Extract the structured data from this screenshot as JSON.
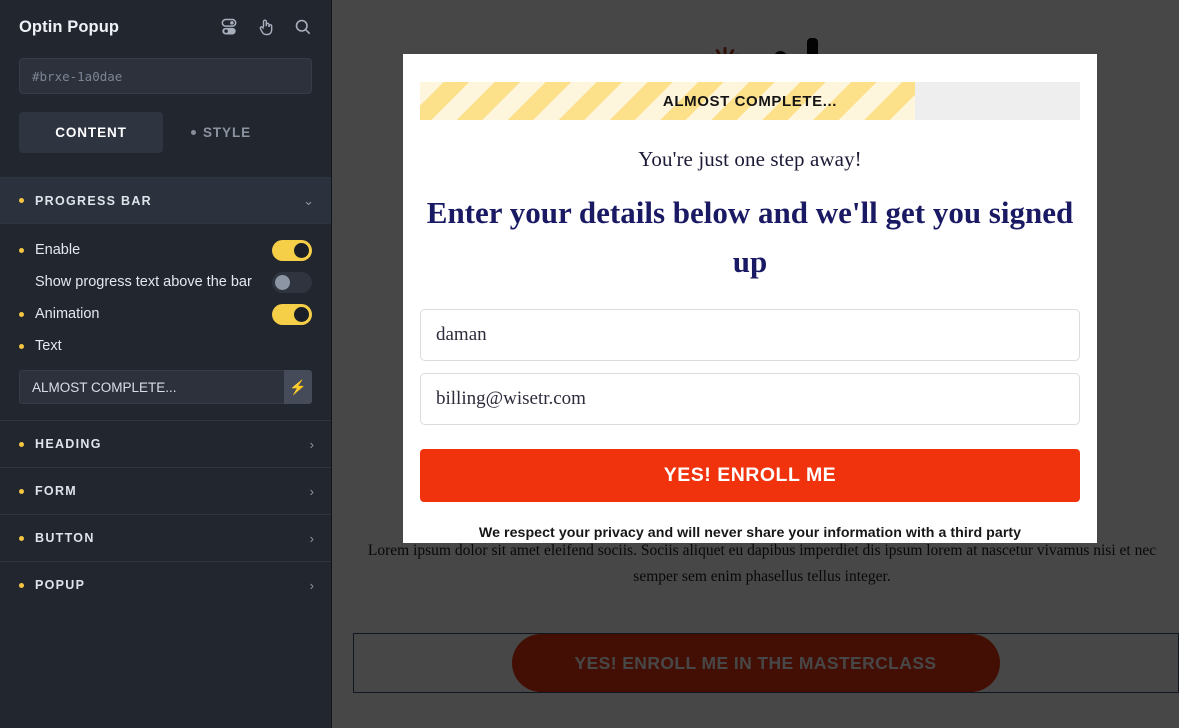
{
  "sidebar": {
    "title": "Optin Popup",
    "icons": [
      {
        "name": "toggle-settings-icon"
      },
      {
        "name": "pointer-hand-icon"
      },
      {
        "name": "search-icon"
      }
    ],
    "element_id": "#brxe-1a0dae",
    "tabs": [
      {
        "label": "CONTENT",
        "active": true
      },
      {
        "label": "STYLE",
        "active": false
      }
    ],
    "sections": [
      {
        "label": "PROGRESS BAR",
        "open": true,
        "chevron": "⌄",
        "controls": [
          {
            "label": "Enable",
            "type": "toggle",
            "state": "on",
            "has_dot": true
          },
          {
            "label": "Show progress text above the bar",
            "type": "toggle",
            "state": "off",
            "has_dot": false
          },
          {
            "label": "Animation",
            "type": "toggle",
            "state": "on",
            "has_dot": true
          },
          {
            "label": "Text",
            "type": "text",
            "value": "ALMOST COMPLETE...",
            "action_icon": "⚡",
            "has_dot": true
          }
        ]
      },
      {
        "label": "HEADING",
        "open": false,
        "chevron": "›"
      },
      {
        "label": "FORM",
        "open": false,
        "chevron": "›"
      },
      {
        "label": "BUTTON",
        "open": false,
        "chevron": "›"
      },
      {
        "label": "POPUP",
        "open": false,
        "chevron": "›"
      }
    ]
  },
  "canvas": {
    "background_paragraph": "Lorem ipsum dolor sit amet eleifend sociis. Sociis aliquet eu dapibus imperdiet dis ipsum lorem at nascetur vivamus nisi et nec semper sem enim phasellus tellus integer.",
    "background_cta_label": "YES! ENROLL ME IN THE MASTERCLASS"
  },
  "popup": {
    "close_icon": "×",
    "progress": {
      "text": "ALMOST COMPLETE...",
      "percent": 75
    },
    "subheading": "You're just one step away!",
    "heading": "Enter your details below and we'll get you signed up",
    "fields": [
      {
        "name": "name-input",
        "value": "daman"
      },
      {
        "name": "email-input",
        "value": "billing@wisetr.com"
      }
    ],
    "submit_label": "YES! ENROLL ME",
    "privacy_note": "We respect your privacy and will never share your information with a third party"
  },
  "colors": {
    "accent_yellow": "#f5cf47",
    "cta_red": "#f0330c",
    "heading_navy": "#191964",
    "sidebar_bg": "#22262f",
    "progress_fill": "#fde9b4"
  }
}
